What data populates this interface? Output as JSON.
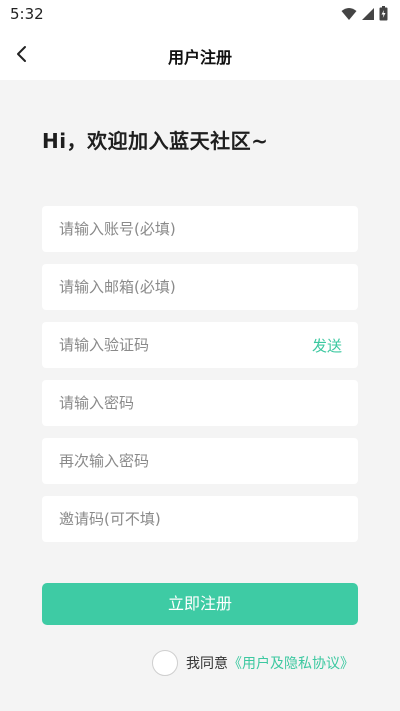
{
  "status_bar": {
    "time": "5:32",
    "icons": [
      "wifi-icon",
      "signal-icon",
      "battery-icon"
    ]
  },
  "nav": {
    "back_icon": "chevron-left-icon",
    "title": "用户注册"
  },
  "greeting": "Hi，欢迎加入蓝天社区~",
  "form": {
    "account_placeholder": "请输入账号(必填)",
    "email_placeholder": "请输入邮箱(必填)",
    "code_placeholder": "请输入验证码",
    "send_label": "发送",
    "password_placeholder": "请输入密码",
    "confirm_password_placeholder": "再次输入密码",
    "invite_placeholder": "邀请码(可不填)"
  },
  "submit_label": "立即注册",
  "agreement": {
    "prefix": "我同意",
    "link": "《用户及隐私协议》"
  },
  "colors": {
    "accent": "#3ecba4",
    "background": "#f4f4f4"
  }
}
